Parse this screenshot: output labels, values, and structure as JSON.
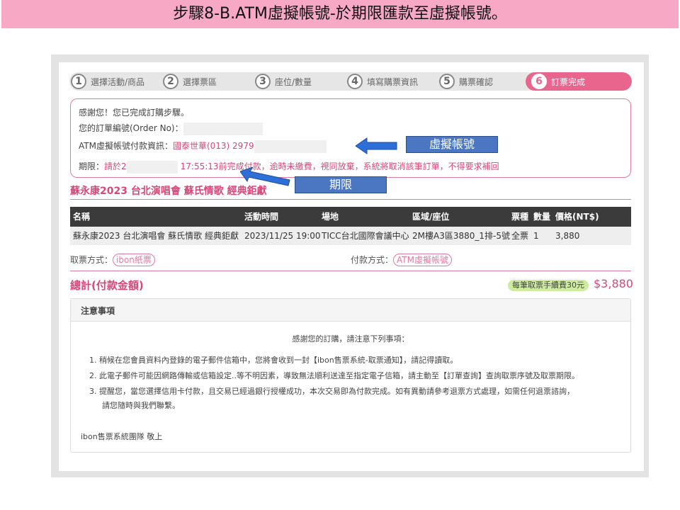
{
  "slide_title": "步驟8-B.ATM虛擬帳號-於期限匯款至虛擬帳號。",
  "steps": [
    {
      "num": "1",
      "label": "選擇活動/商品"
    },
    {
      "num": "2",
      "label": "選擇票區"
    },
    {
      "num": "3",
      "label": "座位/數量"
    },
    {
      "num": "4",
      "label": "填寫購票資訊"
    },
    {
      "num": "5",
      "label": "購票確認"
    },
    {
      "num": "6",
      "label": "訂票完成"
    }
  ],
  "info": {
    "thanks": "感謝您！您已完成訂購步驟。",
    "order_label": "您的訂單編號(Order  No)：",
    "atm_label": "ATM虛擬帳號付款資訊：",
    "atm_value": "國泰世華(013)  2979",
    "deadline_label": "期限：",
    "deadline_prefix": "請於2",
    "deadline_time": "17:55:13",
    "deadline_suffix": "前完成付款，逾時未繳費，視同放棄，系統將取消該筆訂單，不得要求補回"
  },
  "annotations": {
    "virtual_account": "虛擬帳號",
    "deadline": "期限"
  },
  "concert_title": "蘇永康2023  台北演唱會  蘇氏情歌  經典鉅獻",
  "table": {
    "headers": [
      "名稱",
      "活動時間",
      "場地",
      "區域/座位",
      "票種",
      "數量",
      "價格(NT$)"
    ],
    "row": [
      "蘇永康2023  台北演唱會  蘇氏情歌  經典鉅獻",
      "2023/11/25  19:00",
      "TICC台北國際會議中心",
      "2M樓A3區3880_1排-5號",
      "全票",
      "1",
      "3,880"
    ]
  },
  "pickup": {
    "label": "取票方式：",
    "value": "ibon紙票"
  },
  "payment": {
    "label": "付款方式：",
    "value": "ATM虛擬帳號"
  },
  "total": {
    "label": "總計(付款金額)",
    "fee_badge": "每筆取票手續費30元",
    "amount": "$3,880"
  },
  "notes": {
    "title": "注意事項",
    "intro": "感謝您的訂購，請注意下列事項：",
    "items": [
      "稍候在您會員資料內登錄的電子郵件信箱中，您將會收到一封【ibon售票系統-取票通知】，請記得讀取。",
      "此電子郵件可能因網路傳輸或信箱設定..等不明因素，導致無法順利送達至指定電子信箱，請主動至【訂單查詢】查詢取票序號及取票期限。",
      "提醒您，當您選擇信用卡付款，且交易已經過銀行授權成功，本次交易即為付款完成。如有異動請參考退票方式處理，如需任何退票諮詢，"
    ],
    "item3_cont": "請您隨時與我們聯繫。",
    "sign": "ibon售票系統團隊  敬上"
  },
  "colors": {
    "accent": "#e9658e",
    "header_bar": "#f7a8c4",
    "table_head": "#3b3b3b",
    "annotation": "#4a76c2"
  }
}
